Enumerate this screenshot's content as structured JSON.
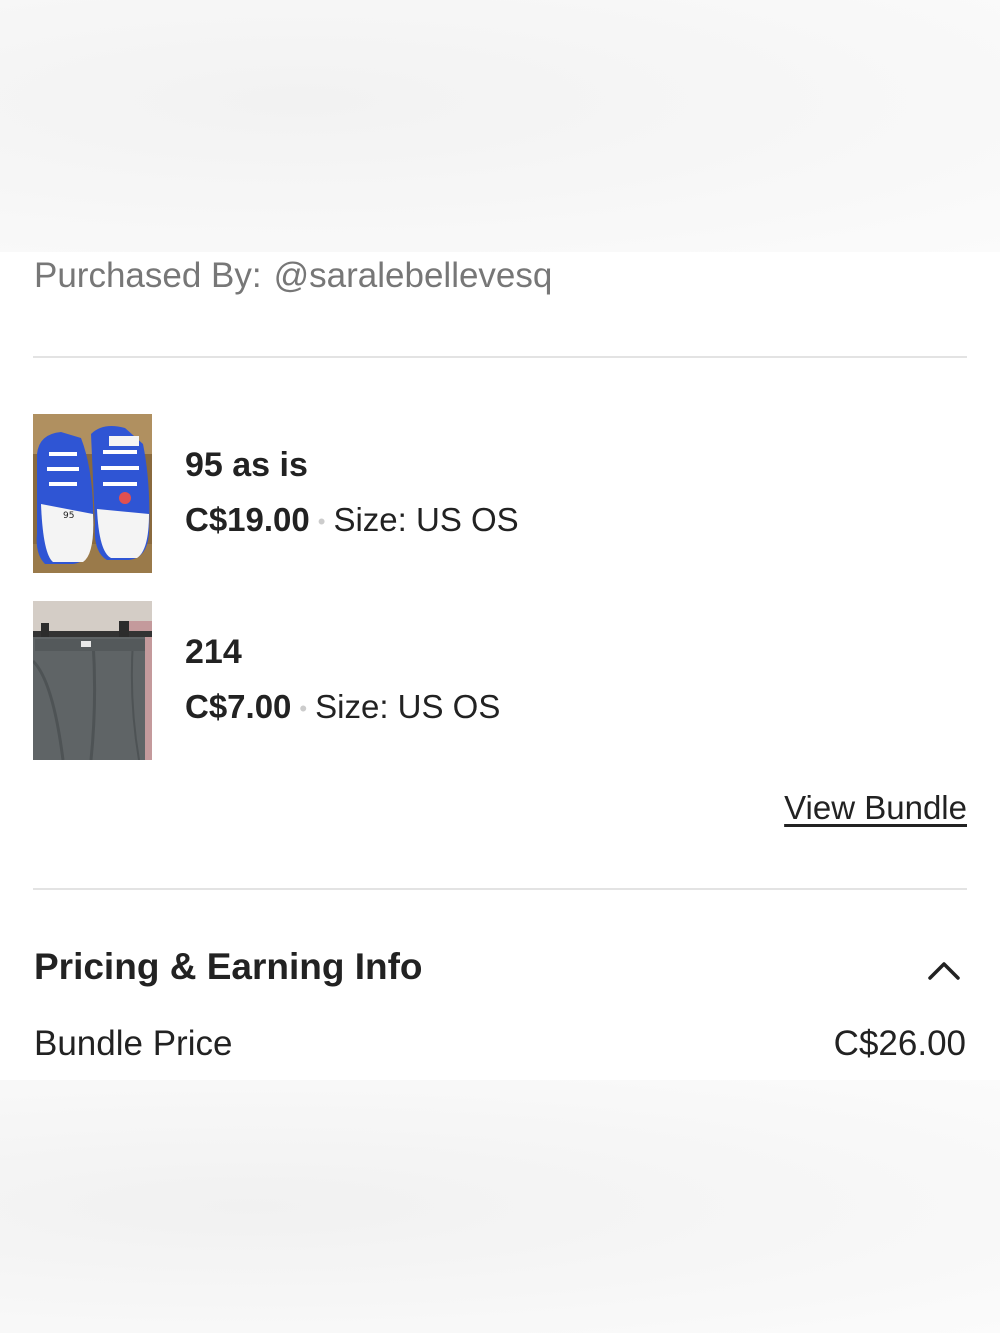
{
  "purchased": {
    "label": "Purchased By:",
    "handle": "@saralebellevesq"
  },
  "items": [
    {
      "title": "95 as is",
      "price": "C$19.00",
      "separator": "•",
      "size": "Size: US OS",
      "thumbnail_icon": "sneakers-photo"
    },
    {
      "title": "214",
      "price": "C$7.00",
      "separator": "•",
      "size": "Size: US OS",
      "thumbnail_icon": "skirt-photo"
    }
  ],
  "view_bundle_label": "View Bundle",
  "pricing": {
    "title": "Pricing & Earning Info",
    "expanded": true,
    "toggle_icon": "chevron-up-icon",
    "rows": [
      {
        "label": "Bundle Price",
        "value": "C$26.00"
      }
    ]
  }
}
